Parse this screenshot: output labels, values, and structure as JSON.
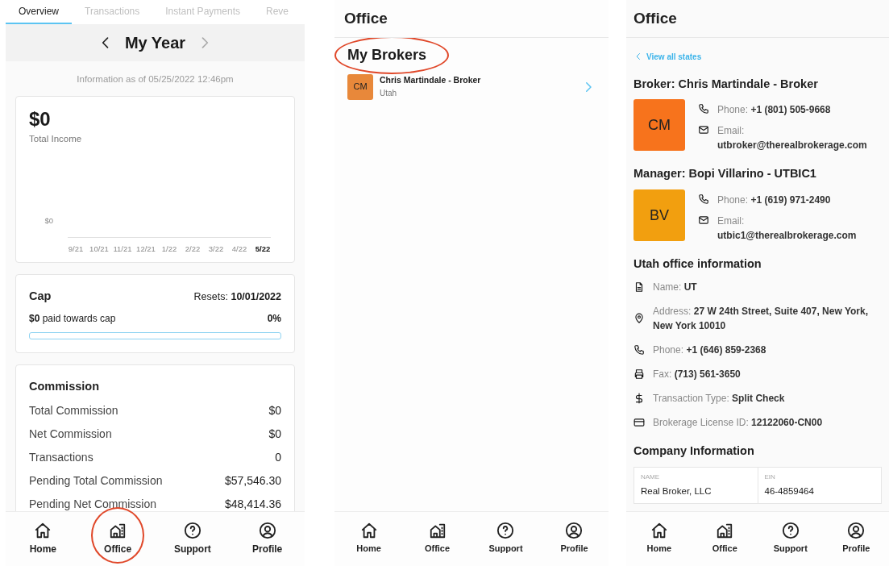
{
  "screens": [
    {
      "kind": "dashboard",
      "tabs": [
        {
          "label": "Overview",
          "selected": true
        },
        {
          "label": "Transactions",
          "selected": false
        },
        {
          "label": "Instant Payments",
          "selected": false
        },
        {
          "label": "Reve",
          "selected": false
        }
      ],
      "period": {
        "title": "My Year",
        "next_disabled": true
      },
      "info": "Information as of 05/25/2022 12:46pm",
      "income": {
        "amount": "$0",
        "label": "Total Income",
        "chart": {
          "y_label": "$0",
          "x_labels": [
            "9/21",
            "10/21",
            "11/21",
            "12/21",
            "1/22",
            "2/22",
            "3/22",
            "4/22",
            "5/22"
          ]
        }
      },
      "cap": {
        "title": "Cap",
        "resets": "Resets: **10/01/2022**",
        "paid": "**$0** paid towards cap",
        "percent": "0%",
        "level": 0
      },
      "commission": {
        "title": "Commission",
        "rows": [
          {
            "label": "Total Commission",
            "value": "$0"
          },
          {
            "label": "Net Commission",
            "value": "$0"
          },
          {
            "label": "Transactions",
            "value": "0"
          },
          {
            "label": "Pending Total Commission",
            "value": "$57,546.30"
          },
          {
            "label": "Pending Net Commission",
            "value": "$48,414.36"
          }
        ]
      },
      "nav": [
        {
          "label": "Home",
          "circled": false
        },
        {
          "label": "Office",
          "circled": true
        },
        {
          "label": "Support",
          "circled": false
        },
        {
          "label": "Profile",
          "circled": false
        }
      ]
    },
    {
      "kind": "brokers",
      "title": "Office",
      "heading": "My Brokers",
      "heading_circled": true,
      "brokers": [
        {
          "initials": "CM",
          "name": "Chris Martindale - Broker",
          "state": "Utah",
          "color": "#e8883a"
        }
      ],
      "nav": [
        {
          "label": "Home",
          "circled": false
        },
        {
          "label": "Office",
          "circled": false
        },
        {
          "label": "Support",
          "circled": false
        },
        {
          "label": "Profile",
          "circled": false
        }
      ]
    },
    {
      "kind": "office",
      "title": "Office",
      "back_link": "View all states",
      "contacts": [
        {
          "heading": "Broker: Chris Martindale - Broker",
          "initials": "CM",
          "color": "#f7731c",
          "lines": [
            {
              "kind": "phone",
              "label": "Phone:",
              "value": "+1 (801) 505-9668"
            },
            {
              "kind": "email",
              "label": "Email:",
              "value": "utbroker@therealbrokerage.com"
            }
          ]
        },
        {
          "heading": "Manager: Bopi Villarino - UTBIC1",
          "initials": "BV",
          "color": "#f29f0f",
          "lines": [
            {
              "kind": "phone",
              "label": "Phone:",
              "value": "+1 (619) 971-2490"
            },
            {
              "kind": "email",
              "label": "Email:",
              "value": "utbic1@therealbrokerage.com"
            }
          ]
        }
      ],
      "office_heading": "Utah office information",
      "office_lines": [
        {
          "kind": "name",
          "label": "Name:",
          "value": "UT"
        },
        {
          "kind": "address",
          "label": "Address:",
          "value": "27 W 24th Street, Suite 407, New York, New York 10010"
        },
        {
          "kind": "phone",
          "label": "Phone:",
          "value": "+1 (646) 859-2368"
        },
        {
          "kind": "fax",
          "label": "Fax:",
          "value": "(713) 561-3650"
        },
        {
          "kind": "transaction",
          "label": "Transaction Type:",
          "value": "Split Check"
        },
        {
          "kind": "license",
          "label": "Brokerage License ID:",
          "value": "12122060-CN00"
        }
      ],
      "company_heading": "Company Information",
      "company": [
        {
          "label": "NAME",
          "value": "Real Broker, LLC"
        },
        {
          "label": "EIN",
          "value": "46-4859464"
        }
      ],
      "nav": [
        {
          "label": "Home",
          "circled": false
        },
        {
          "label": "Office",
          "circled": false
        },
        {
          "label": "Support",
          "circled": false
        },
        {
          "label": "Profile",
          "circled": false
        }
      ]
    }
  ]
}
